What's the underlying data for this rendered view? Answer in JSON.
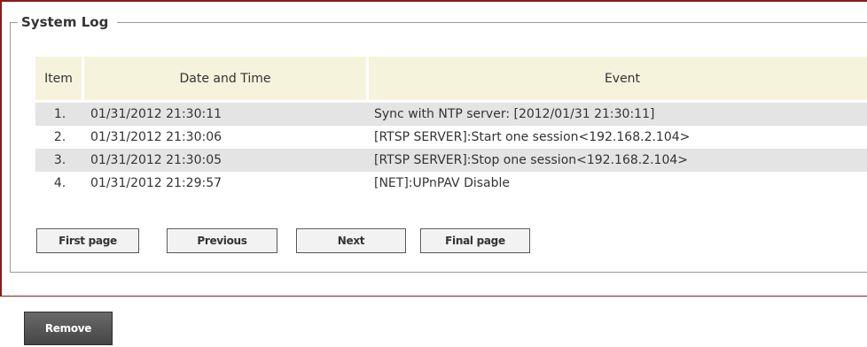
{
  "panel": {
    "title": "System Log"
  },
  "table": {
    "headers": {
      "item": "Item",
      "datetime": "Date and Time",
      "event": "Event"
    },
    "rows": [
      {
        "item": "1.",
        "datetime": "01/31/2012 21:30:11",
        "event": "Sync with NTP server: [2012/01/31 21:30:11]"
      },
      {
        "item": "2.",
        "datetime": "01/31/2012 21:30:06",
        "event": "[RTSP SERVER]:Start one session<192.168.2.104>"
      },
      {
        "item": "3.",
        "datetime": "01/31/2012 21:30:05",
        "event": "[RTSP SERVER]:Stop one session<192.168.2.104>"
      },
      {
        "item": "4.",
        "datetime": "01/31/2012 21:29:57",
        "event": "[NET]:UPnPAV Disable"
      }
    ]
  },
  "pager": {
    "first": "First page",
    "previous": "Previous",
    "next": "Next",
    "final": "Final page"
  },
  "actions": {
    "remove": "Remove"
  },
  "colors": {
    "frame": "#8b1a1a",
    "header_bg": "#f5f3dc",
    "row_shade": "#e4e4e4",
    "remove_bg": "#4f4f4f"
  }
}
